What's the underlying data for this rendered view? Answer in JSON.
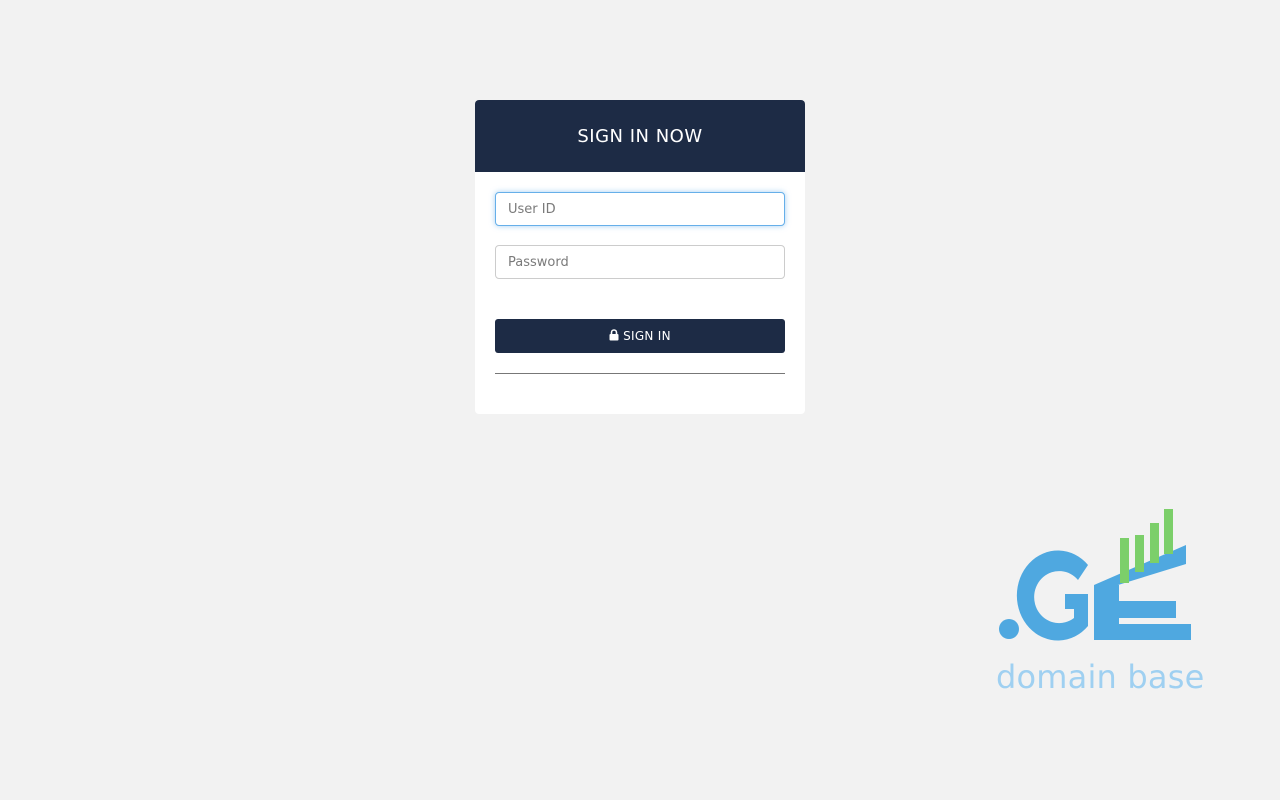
{
  "login": {
    "title": "SIGN IN NOW",
    "user_id_placeholder": "User ID",
    "user_id_value": "",
    "password_placeholder": "Password",
    "password_value": "",
    "signin_label": "SIGN IN",
    "signin_icon": "lock-icon"
  },
  "brand": {
    "logo_mark": ".GE",
    "caption": "domain base",
    "colors": {
      "blue": "#4fa8e0",
      "green": "#7ccf6a",
      "caption": "#9fd0f1"
    }
  },
  "colors": {
    "header_bg": "#1d2b45",
    "page_bg": "#f2f2f2",
    "focus_border": "#66afe9"
  }
}
